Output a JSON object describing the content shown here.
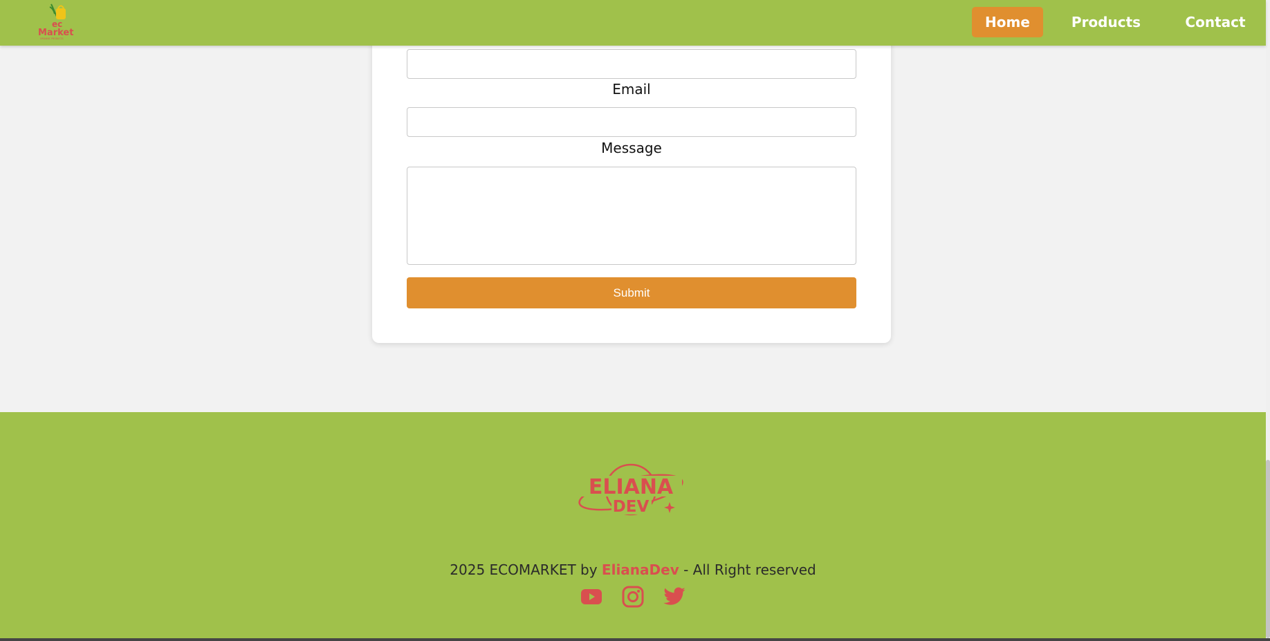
{
  "header": {
    "logo_alt": "ecMarket",
    "logo_text_top": "ec",
    "logo_text_main": "Market",
    "logo_subtext": "ORGANIC PRODUCTS",
    "nav": {
      "home": "Home",
      "products": "Products",
      "contact": "Contact"
    }
  },
  "form": {
    "name_value": "",
    "email_label": "Email",
    "email_value": "",
    "message_label": "Message",
    "message_value": "",
    "submit_label": "Submit"
  },
  "footer": {
    "brand_line1": "ELIANA",
    "brand_line2": "DEV",
    "copyright_prefix": "2025 ECOMARKET by ",
    "copyright_author": "ElianaDev",
    "copyright_suffix": " - All Right reserved",
    "social_icons": [
      "youtube-icon",
      "instagram-icon",
      "twitter-icon"
    ]
  },
  "colors": {
    "brand_green": "#a0c14b",
    "accent_orange": "#e08f2f",
    "accent_red": "#d94f4f"
  }
}
